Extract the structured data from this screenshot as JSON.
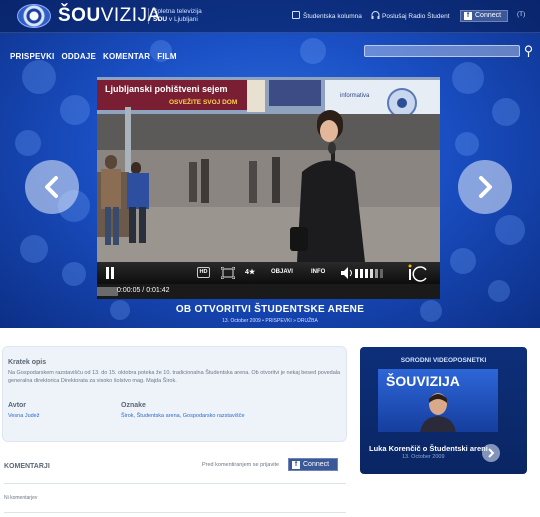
{
  "header": {
    "logo_bold": "ŠOU",
    "logo_thin": "VIZIJA",
    "tagline_line1": "Spletna televizija",
    "tagline_line2_bold": "ŠOU",
    "tagline_line2_rest": " v Ljubljani",
    "links": [
      "Študentska kolumna",
      "Poslušaj Radio Študent"
    ],
    "facebook_label": "Connect",
    "t_mark": "(T)"
  },
  "nav": {
    "items": [
      "PRISPEVKI",
      "ODDAJE",
      "KOMENTAR",
      "FILM"
    ]
  },
  "search": {
    "placeholder": ""
  },
  "video": {
    "banner_text": "Ljubljanski pohištveni sejem",
    "banner_sub": "OSVEŽITE SVOJ DOM",
    "informativa_text": "informativa",
    "controls": {
      "hd": "HD",
      "rating": "4★",
      "objavi": "OBJAVI",
      "info": "INFO"
    },
    "progress_fraction": 0.06,
    "time": "0:00:05 / 0:01:42",
    "title": "OB OTVORITVI ŠTUDENTSKE ARENE",
    "meta": "13. October 2009   •   PRISPEVKI » DRUŽBA"
  },
  "description": {
    "heading": "Kratek opis",
    "text": "Na Gospodarskem razstavišču od 13. do 15. oktobra poteka že 10. tradicionalna Študentska arena. Ob otvoritvi je nekaj besed povedala generalna direktorica Direktorata za visoko šolstvo mag. Majda Širok.",
    "author_label": "Avtor",
    "author": "Vesna Judež",
    "tags_label": "Oznake",
    "tags": "Širok, Študentska arena, Gospodarsko razstavišče"
  },
  "related": {
    "heading": "SORODNI VIDEOPOSNETKI",
    "thumb_logo": "ŠOUVIZIJA",
    "item_title": "Luka Korenčič o Študentski areni",
    "item_date": "13. October 2009"
  },
  "comments": {
    "heading": "KOMENTARJI",
    "login_text": "Pred komentiranjem se prijavite",
    "facebook_label": "Connect",
    "empty_text": "Ni komentarjev"
  }
}
